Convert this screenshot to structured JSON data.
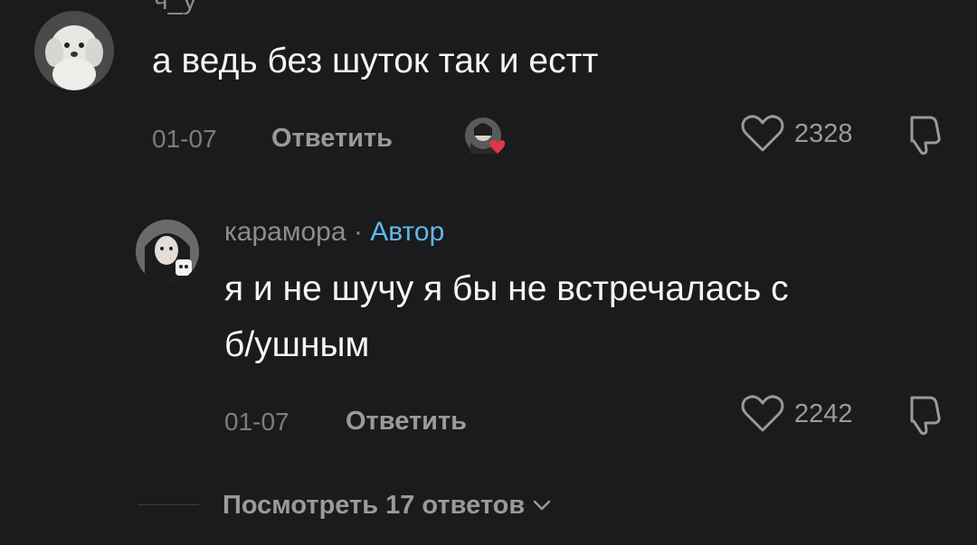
{
  "comment": {
    "username": "ч_у",
    "text": "а ведь без шуток так и естт",
    "date": "01-07",
    "reply_label": "Ответить",
    "likes": "2328",
    "avatar_icon": "dog-avatar-icon",
    "liked_by_creator_icon": "creator-heart-avatar-icon"
  },
  "reply": {
    "username": "карамора",
    "separator": "·",
    "badge": "Автор",
    "text_line1": "я и не шучу я бы не встречалась с",
    "text_line2": "б/ушным",
    "date": "01-07",
    "reply_label": "Ответить",
    "likes": "2242",
    "avatar_icon": "girl-avatar-icon"
  },
  "view_replies": {
    "label": "Посмотреть 17 ответов",
    "icon": "chevron-down-icon"
  },
  "colors": {
    "background": "#1b1b1d",
    "author_badge": "#5fb8ea",
    "heart_red": "#e8344a"
  }
}
